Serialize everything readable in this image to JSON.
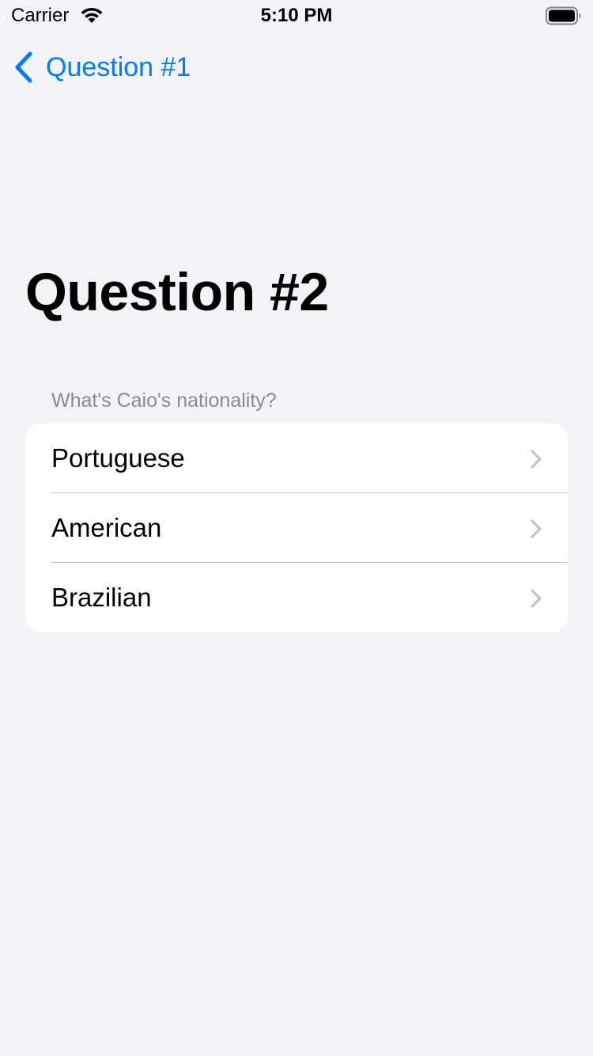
{
  "status_bar": {
    "carrier": "Carrier",
    "time": "5:10 PM",
    "wifi_icon": "wifi-icon",
    "battery_icon": "battery-full-icon"
  },
  "nav": {
    "back_label": "Question #1",
    "back_icon": "chevron-left-icon",
    "accent_color": "#007aff"
  },
  "page": {
    "title": "Question #2",
    "background_color": "#f2f2f7"
  },
  "question": {
    "prompt": "What's Caio's nationality?",
    "options": [
      {
        "label": "Portuguese",
        "icon": "chevron-right-icon"
      },
      {
        "label": "American",
        "icon": "chevron-right-icon"
      },
      {
        "label": "Brazilian",
        "icon": "chevron-right-icon"
      }
    ]
  }
}
